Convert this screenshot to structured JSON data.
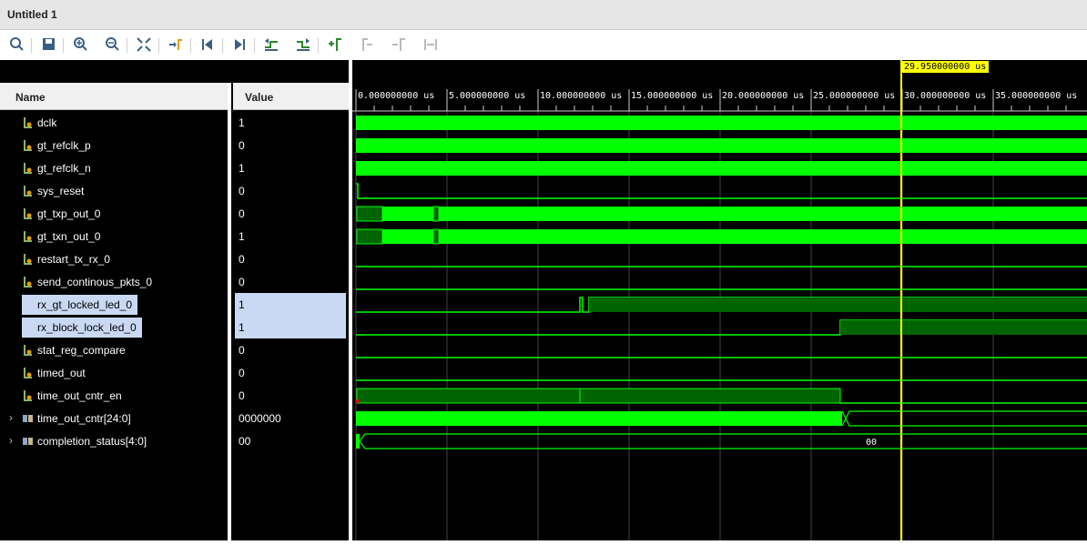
{
  "window": {
    "title": "Untitled 1"
  },
  "toolbar": {
    "buttons": [
      {
        "name": "search-icon"
      },
      {
        "name": "save-icon"
      },
      {
        "name": "zoom-in-icon"
      },
      {
        "name": "zoom-out-icon"
      },
      {
        "name": "zoom-fit-icon"
      },
      {
        "name": "go-to-cursor-icon"
      },
      {
        "name": "go-to-start-icon"
      },
      {
        "name": "go-to-end-icon"
      },
      {
        "name": "previous-transition-icon"
      },
      {
        "name": "next-transition-icon"
      },
      {
        "name": "add-marker-icon"
      },
      {
        "name": "previous-marker-icon"
      },
      {
        "name": "next-marker-icon"
      },
      {
        "name": "swap-cursors-icon"
      }
    ]
  },
  "columns": {
    "name": "Name",
    "value": "Value"
  },
  "signals": [
    {
      "name": "dclk",
      "value": "1",
      "type": "bit"
    },
    {
      "name": "gt_refclk_p",
      "value": "0",
      "type": "bit"
    },
    {
      "name": "gt_refclk_n",
      "value": "1",
      "type": "bit"
    },
    {
      "name": "sys_reset",
      "value": "0",
      "type": "bit"
    },
    {
      "name": "gt_txp_out_0",
      "value": "0",
      "type": "bit"
    },
    {
      "name": "gt_txn_out_0",
      "value": "1",
      "type": "bit"
    },
    {
      "name": "restart_tx_rx_0",
      "value": "0",
      "type": "bit"
    },
    {
      "name": "send_continous_pkts_0",
      "value": "0",
      "type": "bit"
    },
    {
      "name": "rx_gt_locked_led_0",
      "value": "1",
      "type": "bit",
      "selected": true
    },
    {
      "name": "rx_block_lock_led_0",
      "value": "1",
      "type": "bit",
      "selected": true
    },
    {
      "name": "stat_reg_compare",
      "value": "0",
      "type": "bit"
    },
    {
      "name": "timed_out",
      "value": "0",
      "type": "bit"
    },
    {
      "name": "time_out_cntr_en",
      "value": "0",
      "type": "bit"
    },
    {
      "name": "time_out_cntr[24:0]",
      "value": "0000000",
      "type": "bus"
    },
    {
      "name": "completion_status[4:0]",
      "value": "00",
      "type": "bus"
    }
  ],
  "ruler": {
    "labels": [
      "0.000000000 us",
      "5.000000000 us",
      "10.000000000 us",
      "15.000000000 us",
      "20.000000000 us",
      "25.000000000 us",
      "30.000000000 us",
      "35.000000000 us"
    ]
  },
  "cursor": {
    "label": "29.950000000 us",
    "time_us": 29.95
  },
  "bus_values": {
    "completion_status": "00"
  },
  "colors": {
    "wave": "#00ff00",
    "wave_dark": "#006400",
    "cursor": "#ffff00",
    "background": "#000000",
    "grid": "#444444"
  }
}
